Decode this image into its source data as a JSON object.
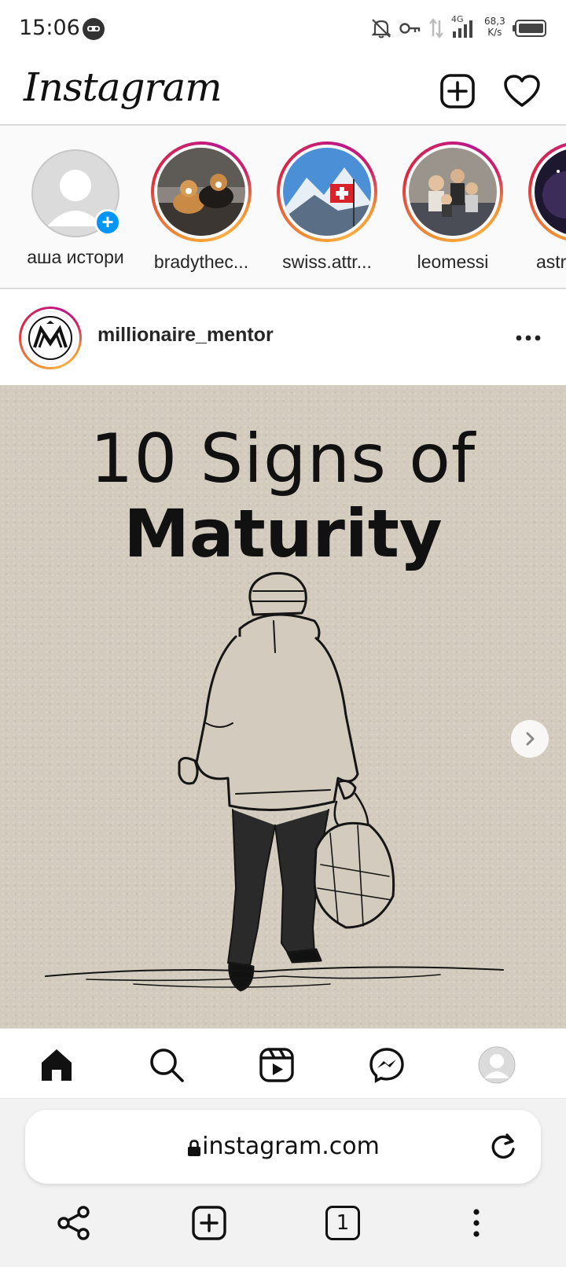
{
  "status_bar": {
    "time": "15:06",
    "speed_value": "68,3",
    "speed_unit": "K/s",
    "network": "4G"
  },
  "header": {
    "logo": "Instagram",
    "new_post_icon": "plus-square-icon",
    "activity_icon": "heart-icon"
  },
  "stories": [
    {
      "label": "аша истори",
      "type": "own"
    },
    {
      "label": "bradythec...",
      "type": "story"
    },
    {
      "label": "swiss.attr...",
      "type": "story"
    },
    {
      "label": "leomessi",
      "type": "story"
    },
    {
      "label": "astro",
      "type": "story"
    }
  ],
  "post": {
    "username": "millionaire_mentor",
    "title_line1": "10 Signs of",
    "title_line2": "Maturity",
    "avatar_letters": "M"
  },
  "bottom_nav": {
    "items": [
      "home-icon",
      "search-icon",
      "reels-icon",
      "messenger-icon",
      "profile-avatar"
    ]
  },
  "browser": {
    "url": "instagram.com",
    "tab_count": "1"
  },
  "colors": {
    "accent": "#0095f6",
    "ring_start": "#f09433",
    "ring_end": "#bc1888",
    "post_bg": "#d3cbbd"
  }
}
